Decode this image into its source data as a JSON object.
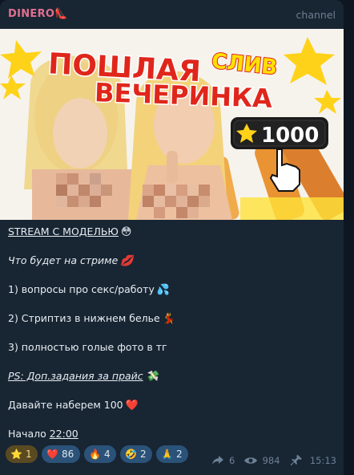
{
  "post": {
    "channel_name": "DINERO",
    "channel_emoji": "👠",
    "channel_tag": "channel"
  },
  "media": {
    "title_line1": "ПОШЛАЯ",
    "title_line2": "ВЕЧЕРИНКА",
    "title_word": "СЛИВ",
    "price_badge": "1000",
    "star_icon": "star-icon"
  },
  "message": {
    "lines": [
      {
        "text": "STREAM С МОДЕЛЬЮ",
        "emoji": "😳"
      },
      {
        "text": "Что будет на стриме",
        "emoji": "💋"
      },
      {
        "text": "1) вопросы про секс/работу",
        "emoji": "💦"
      },
      {
        "text": "2) Стриптиз в нижнем белье",
        "emoji": "💃"
      },
      {
        "text": "3) полностью голые фото в тг",
        "emoji": ""
      },
      {
        "text": "PS: Доп.задания за прайс",
        "emoji": "💸"
      },
      {
        "text": "Давайте наберем 100",
        "emoji": "❤️"
      },
      {
        "text_prefix": "Начало ",
        "time_link": "22:00"
      }
    ]
  },
  "reactions": [
    {
      "emoji": "⭐",
      "count": "1",
      "active": true
    },
    {
      "emoji": "❤️",
      "count": "86",
      "active": false
    },
    {
      "emoji": "🔥",
      "count": "4",
      "active": false
    },
    {
      "emoji": "🤣",
      "count": "2",
      "active": false
    },
    {
      "emoji": "🙏",
      "count": "2",
      "active": false
    }
  ],
  "meta": {
    "forwards": "6",
    "views": "984",
    "time": "15:13"
  },
  "colors": {
    "background": "#0e1621",
    "bubble": "#182533",
    "channel_name": "#e06f8f",
    "reaction_bg": "#2b5278",
    "reaction_active_bg": "#5a4a22",
    "text": "#e7edf2",
    "meta": "#6d8196",
    "title_red": "#e0261b",
    "title_yellow": "#ffe000"
  }
}
